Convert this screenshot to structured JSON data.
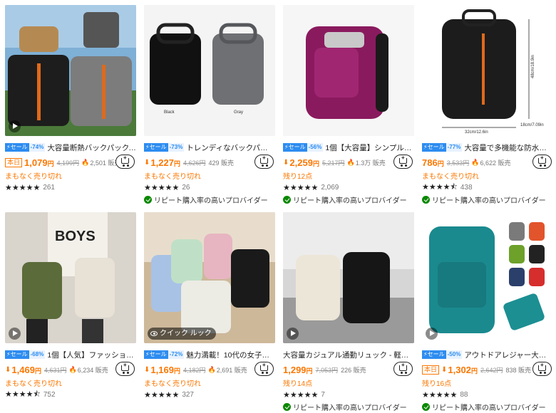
{
  "products": [
    {
      "sale_label": "⚡セール",
      "discount": "-74%",
      "title": "大容量断熱バックパック、防水…",
      "today_badge": "本日",
      "price": "1,079",
      "yen": "円",
      "original_price": "4,199円",
      "sold": "2,501 販売",
      "status": "まもなく売り切れ",
      "stars": "★★★★★",
      "reviews": "261",
      "provider": "",
      "quick_look": ""
    },
    {
      "sale_label": "⚡セール",
      "discount": "-73%",
      "title": "トレンディなバックパック、メンズ…",
      "today_badge": "",
      "price": "1,227",
      "yen": "円",
      "original_price": "4,626円",
      "sold": "429 販売",
      "status": "まもなく売り切れ",
      "stars": "★★★★★",
      "reviews": "26",
      "provider": "リピート購入率の高いプロバイダー",
      "quick_look": "",
      "image_labels": [
        "Black",
        "Gray"
      ]
    },
    {
      "sale_label": "⚡セール",
      "discount": "-56%",
      "title": "1個【大容量】シンプル　ソリッ…",
      "today_badge": "",
      "price": "2,259",
      "yen": "円",
      "original_price": "5,217円",
      "sold": "1.3万 販売",
      "status": "残り12点",
      "stars": "★★★★★",
      "reviews": "2,069",
      "provider": "リピート購入率の高いプロバイダー",
      "quick_look": ""
    },
    {
      "sale_label": "⚡セール",
      "discount": "-77%",
      "title": "大容量で多機能な防水・耐久…",
      "today_badge": "",
      "price": "786",
      "yen": "円",
      "original_price": "3,533円",
      "sold": "6,622 販売",
      "status": "まもなく売り切れ",
      "stars": "★★★★⯪",
      "reviews": "438",
      "provider": "リピート購入率の高いプロバイダー",
      "quick_look": "",
      "image_labels": [
        "48cm/18.9in",
        "32cm/12.6in",
        "18cm/7.09in"
      ]
    },
    {
      "sale_label": "⚡セール",
      "discount": "-68%",
      "title": "1個【人気】ファッション　エレガ…",
      "today_badge": "",
      "price": "1,469",
      "yen": "円",
      "original_price": "4,631円",
      "sold": "6,234 販売",
      "status": "まもなく売り切れ",
      "stars": "★★★★⯪",
      "reviews": "752",
      "provider": "",
      "quick_look": "",
      "image_labels": [
        "BOYS"
      ]
    },
    {
      "sale_label": "⚡セール",
      "discount": "-72%",
      "title": "魅力満載！10代の女子高生…",
      "today_badge": "",
      "price": "1,169",
      "yen": "円",
      "original_price": "4,182円",
      "sold": "2,691 販売",
      "status": "まもなく売り切れ",
      "stars": "★★★★★",
      "reviews": "327",
      "provider": "",
      "quick_look": "クイック ルック"
    },
    {
      "sale_label": "",
      "discount": "",
      "title": "大容量カジュアル通勤リュック - 軽量ナイロン…",
      "today_badge": "",
      "price": "1,299",
      "yen": "円",
      "original_price": "7,053円",
      "sold": "226 販売",
      "status": "残り14点",
      "stars": "★★★★★",
      "reviews": "7",
      "provider": "リピート購入率の高いプロバイダー",
      "quick_look": ""
    },
    {
      "sale_label": "⚡セール",
      "discount": "-50%",
      "title": "アウトドアレジャー大容量軽量…",
      "today_badge": "本日",
      "price": "1,302",
      "yen": "円",
      "original_price": "2,642円",
      "sold": "838 販売",
      "status": "残り16点",
      "stars": "★★★★★",
      "reviews": "88",
      "provider": "リピート購入率の高いプロバイダー",
      "quick_look": ""
    }
  ],
  "colors": {
    "accent": "#fb7701",
    "sale_blue": "#2d8cf0",
    "provider_check": "#0a8800"
  },
  "icons": [
    "play-icon",
    "cart-plus-icon",
    "fire-icon",
    "price-drop-icon",
    "check-badge-icon",
    "eye-icon"
  ]
}
